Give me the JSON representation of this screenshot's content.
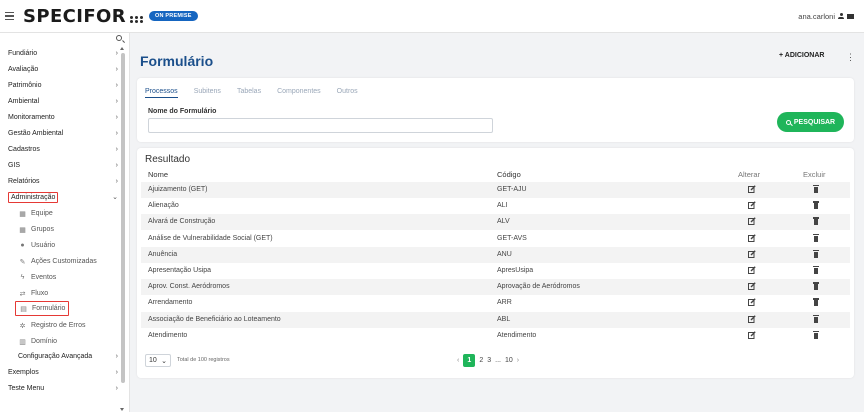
{
  "header": {
    "logo_text": "SPECIFOR",
    "badge": "ON PREMISE",
    "user": "ana.carloni"
  },
  "sidebar": {
    "items": [
      {
        "label": "Fundiário",
        "chevron": "›"
      },
      {
        "label": "Avaliação",
        "chevron": "›"
      },
      {
        "label": "Patrimônio",
        "chevron": "›"
      },
      {
        "label": "Ambiental",
        "chevron": "›"
      },
      {
        "label": "Monitoramento",
        "chevron": "›"
      },
      {
        "label": "Gestão Ambiental",
        "chevron": "›"
      },
      {
        "label": "Cadastros",
        "chevron": "›"
      },
      {
        "label": "GIS",
        "chevron": "›"
      },
      {
        "label": "Relatórios",
        "chevron": "›"
      },
      {
        "label": "Administração",
        "chevron": "⌄"
      }
    ],
    "sub_items": [
      {
        "label": "Equipe",
        "icon": "team-icon"
      },
      {
        "label": "Grupos",
        "icon": "groups-icon"
      },
      {
        "label": "Usuário",
        "icon": "user-icon"
      },
      {
        "label": "Ações Customizadas",
        "icon": "actions-icon"
      },
      {
        "label": "Eventos",
        "icon": "bolt-icon"
      },
      {
        "label": "Fluxo",
        "icon": "flow-icon"
      },
      {
        "label": "Formulário",
        "icon": "form-icon"
      },
      {
        "label": "Registro de Erros",
        "icon": "gear-icon"
      },
      {
        "label": "Domínio",
        "icon": "table-icon"
      }
    ],
    "bottom_items": [
      {
        "label": "Configuração Avançada",
        "chevron": "›"
      },
      {
        "label": "Exemplos",
        "chevron": "›"
      },
      {
        "label": "Teste Menu",
        "chevron": "›"
      }
    ]
  },
  "main": {
    "title": "Formulário",
    "add_label": "+ ADICIONAR",
    "kebab": "⋮",
    "tabs": [
      "Processos",
      "Subitens",
      "Tabelas",
      "Componentes",
      "Outros"
    ],
    "field_label": "Nome do Formulário",
    "field_value": "",
    "search_label": "PESQUISAR"
  },
  "results": {
    "title": "Resultado",
    "columns": {
      "nome": "Nome",
      "codigo": "Código",
      "alterar": "Alterar",
      "excluir": "Excluir"
    },
    "rows": [
      {
        "nome": "Ajuizamento (GET)",
        "codigo": "GET-AJU"
      },
      {
        "nome": "Alienação",
        "codigo": "ALI"
      },
      {
        "nome": "Alvará de Construção",
        "codigo": "ALV"
      },
      {
        "nome": "Análise de Vulnerabilidade Social (GET)",
        "codigo": "GET-AVS"
      },
      {
        "nome": "Anuência",
        "codigo": "ANU"
      },
      {
        "nome": "Apresentação Usipa",
        "codigo": "ApresUsipa"
      },
      {
        "nome": "Aprov. Const. Aeródromos",
        "codigo": "Aprovação de Aeródromos"
      },
      {
        "nome": "Arrendamento",
        "codigo": "ARR"
      },
      {
        "nome": "Associação de Beneficiário ao Loteamento",
        "codigo": "ABL"
      },
      {
        "nome": "Atendimento",
        "codigo": "Atendimento"
      }
    ],
    "page_size": "10",
    "total_text": "Total de 100 registros",
    "pages": {
      "prev": "‹",
      "p1": "1",
      "p2": "2",
      "p3": "3",
      "ellipsis": "...",
      "p10": "10",
      "next": "›"
    }
  },
  "colors": {
    "brand_blue": "#1b4f8b",
    "badge_blue": "#1565c0",
    "green": "#1fb55a",
    "highlight_red": "#e53935"
  }
}
